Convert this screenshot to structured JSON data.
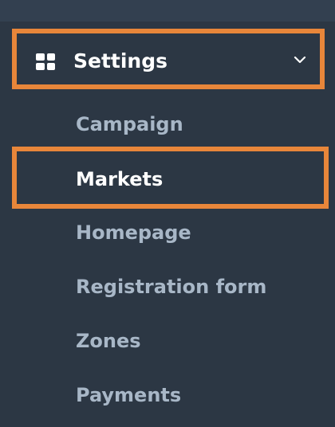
{
  "nav": {
    "settings": {
      "label": "Settings",
      "icon": "grid-icon",
      "expanded": true,
      "chevron": "chevron-down-icon"
    },
    "items": [
      {
        "label": "Campaign"
      },
      {
        "label": "Markets",
        "active": true
      },
      {
        "label": "Homepage"
      },
      {
        "label": "Registration form"
      },
      {
        "label": "Zones"
      },
      {
        "label": "Payments"
      }
    ]
  },
  "colors": {
    "background": "#2c3744",
    "topbar": "#334050",
    "highlight_border": "#e8863a",
    "active_text": "#ffffff",
    "inactive_text": "#a8b7c7"
  }
}
